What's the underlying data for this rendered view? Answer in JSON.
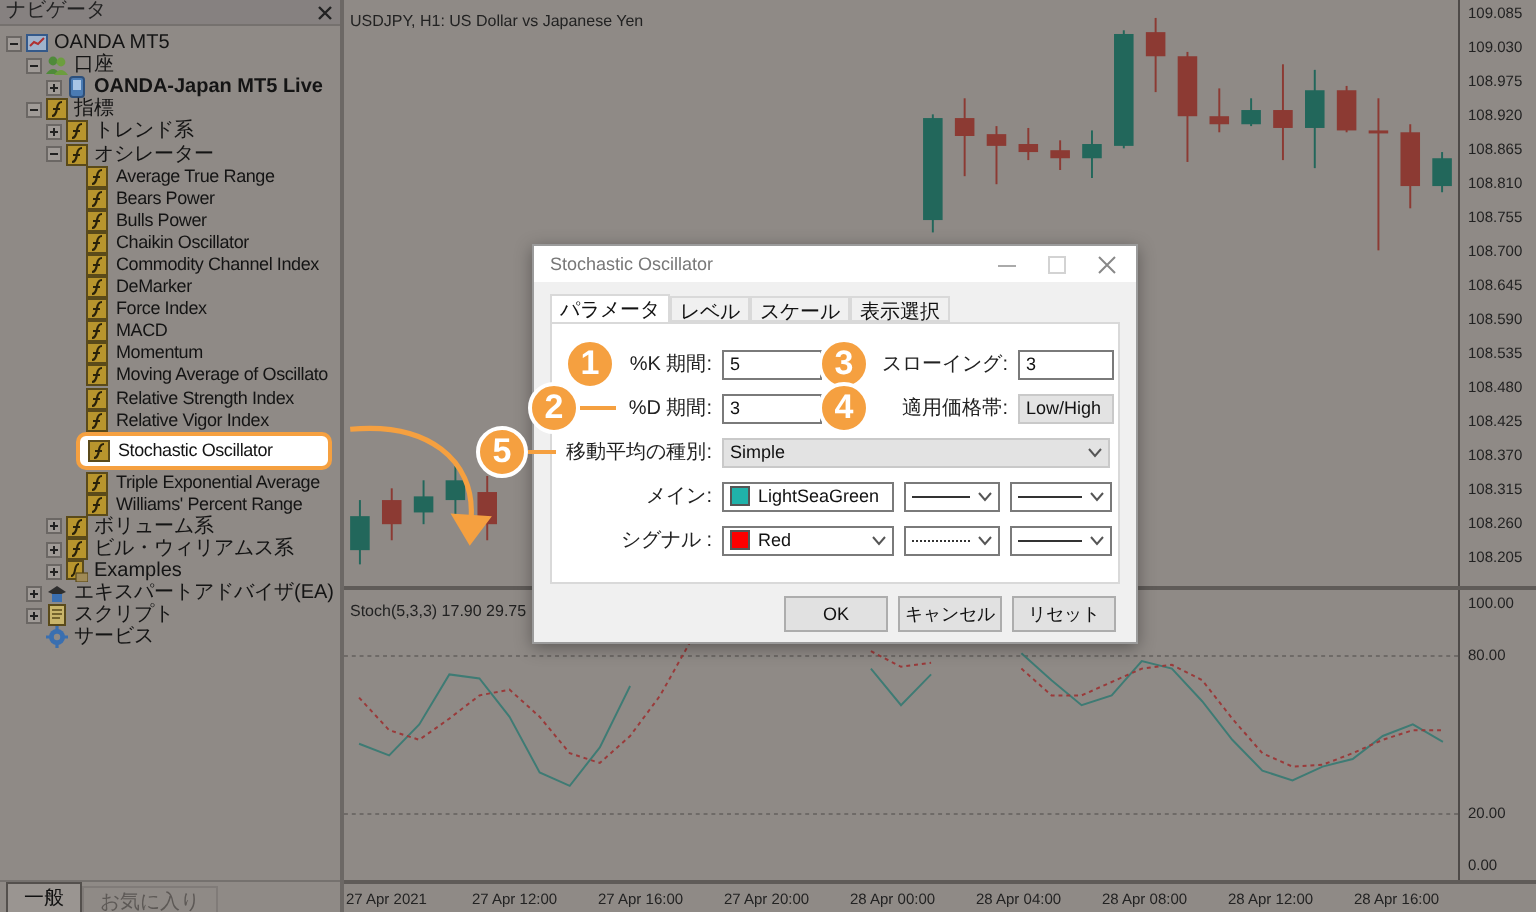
{
  "navigator": {
    "title": "ナビゲータ",
    "tree": [
      {
        "label": "OANDA MT5",
        "kind": "terminal",
        "expanded": true,
        "children": [
          {
            "label": "口座",
            "kind": "accounts",
            "expanded": true,
            "children": [
              {
                "label": "OANDA-Japan MT5 Live",
                "kind": "account",
                "expanded": false
              }
            ]
          },
          {
            "label": "指標",
            "kind": "indicator",
            "expanded": true,
            "children": [
              {
                "label": "トレンド系",
                "kind": "indicator",
                "expanded": false
              },
              {
                "label": "オシレーター",
                "kind": "indicator",
                "expanded": true,
                "children": [
                  {
                    "label": "Average True Range",
                    "kind": "indicator",
                    "highlighted": false
                  },
                  {
                    "label": "Bears Power",
                    "kind": "indicator",
                    "highlighted": false
                  },
                  {
                    "label": "Bulls Power",
                    "kind": "indicator",
                    "highlighted": false
                  },
                  {
                    "label": "Chaikin Oscillator",
                    "kind": "indicator",
                    "highlighted": false
                  },
                  {
                    "label": "Commodity Channel Index",
                    "kind": "indicator",
                    "highlighted": false
                  },
                  {
                    "label": "DeMarker",
                    "kind": "indicator",
                    "highlighted": false
                  },
                  {
                    "label": "Force Index",
                    "kind": "indicator",
                    "highlighted": false
                  },
                  {
                    "label": "MACD",
                    "kind": "indicator",
                    "highlighted": false
                  },
                  {
                    "label": "Momentum",
                    "kind": "indicator",
                    "highlighted": false
                  },
                  {
                    "label": "Moving Average of Oscillato",
                    "kind": "indicator",
                    "highlighted": false
                  },
                  {
                    "label": "Relative Strength Index",
                    "kind": "indicator",
                    "highlighted": false
                  },
                  {
                    "label": "Relative Vigor Index",
                    "kind": "indicator",
                    "highlighted": false
                  },
                  {
                    "label": "Stochastic Oscillator",
                    "kind": "indicator",
                    "highlighted": true
                  },
                  {
                    "label": "Triple Exponential Average",
                    "kind": "indicator",
                    "highlighted": false
                  },
                  {
                    "label": "Williams' Percent Range",
                    "kind": "indicator",
                    "highlighted": false
                  }
                ]
              },
              {
                "label": "ボリューム系",
                "kind": "indicator",
                "expanded": false
              },
              {
                "label": "ビル・ウィリアムス系",
                "kind": "indicator",
                "expanded": false
              },
              {
                "label": "Examples",
                "kind": "indicator-folder",
                "expanded": false
              }
            ]
          },
          {
            "label": "エキスパートアドバイザ(EA)",
            "kind": "expert",
            "expanded": false
          },
          {
            "label": "スクリプト",
            "kind": "script",
            "expanded": false
          },
          {
            "label": "サービス",
            "kind": "service"
          }
        ]
      }
    ],
    "tabs": [
      {
        "label": "一般",
        "selected": true
      },
      {
        "label": "お気に入り",
        "selected": false
      }
    ]
  },
  "chart": {
    "title": "USDJPY, H1:  US Dollar vs Japanese Yen",
    "chart_data": {
      "type": "candlestick",
      "ylim": [
        108.16,
        109.108
      ],
      "yticks": [
        {
          "value": 109.085,
          "label": "109.085"
        },
        {
          "value": 109.03,
          "label": "109.030"
        },
        {
          "value": 108.975,
          "label": "108.975"
        },
        {
          "value": 108.92,
          "label": "108.920"
        },
        {
          "value": 108.865,
          "label": "108.865"
        },
        {
          "value": 108.81,
          "label": "108.810"
        },
        {
          "value": 108.755,
          "label": "108.755"
        },
        {
          "value": 108.7,
          "label": "108.700"
        },
        {
          "value": 108.645,
          "label": "108.645"
        },
        {
          "value": 108.59,
          "label": "108.590"
        },
        {
          "value": 108.535,
          "label": "108.535"
        },
        {
          "value": 108.48,
          "label": "108.480"
        },
        {
          "value": 108.425,
          "label": "108.425"
        },
        {
          "value": 108.37,
          "label": "108.370"
        },
        {
          "value": 108.315,
          "label": "108.315"
        },
        {
          "value": 108.26,
          "label": "108.260"
        },
        {
          "value": 108.205,
          "label": "108.205"
        }
      ],
      "ohlc": [
        [
          108.218,
          108.299,
          108.195,
          108.273
        ],
        [
          108.299,
          108.318,
          108.234,
          108.26
        ],
        [
          108.279,
          108.331,
          108.26,
          108.305
        ],
        [
          108.299,
          108.354,
          108.273,
          108.331
        ],
        [
          108.312,
          108.338,
          108.234,
          108.26
        ],
        null,
        null,
        null,
        null,
        null,
        null,
        null,
        null,
        null,
        null,
        null,
        null,
        null,
        [
          108.752,
          108.923,
          108.732,
          108.917
        ],
        [
          108.917,
          108.949,
          108.823,
          108.888
        ],
        [
          108.891,
          108.904,
          108.81,
          108.872
        ],
        [
          108.875,
          108.901,
          108.849,
          108.862
        ],
        [
          108.865,
          108.881,
          108.833,
          108.852
        ],
        [
          108.852,
          108.897,
          108.82,
          108.875
        ],
        [
          108.872,
          109.059,
          108.868,
          109.053
        ],
        [
          109.056,
          109.079,
          108.959,
          109.017
        ],
        [
          109.017,
          109.024,
          108.846,
          108.92
        ],
        [
          108.92,
          108.965,
          108.894,
          108.907
        ],
        [
          108.907,
          108.949,
          108.904,
          108.93
        ],
        [
          108.93,
          109.004,
          108.849,
          108.901
        ],
        [
          108.901,
          108.995,
          108.836,
          108.962
        ],
        [
          108.962,
          108.969,
          108.894,
          108.897
        ],
        [
          108.897,
          108.949,
          108.703,
          108.894
        ],
        [
          108.894,
          108.907,
          108.771,
          108.807
        ],
        [
          108.807,
          108.862,
          108.797,
          108.852
        ]
      ]
    },
    "indicator": {
      "label": "Stoch(5,3,3) 17.90 29.75",
      "chart_data": {
        "type": "line",
        "ylim": [
          -5,
          105
        ],
        "grid": true,
        "yticks": [
          {
            "value": 100,
            "label": "100.00"
          },
          {
            "value": 80,
            "label": "80.00"
          },
          {
            "value": 20,
            "label": "20.00"
          },
          {
            "value": 0,
            "label": "0.00"
          }
        ],
        "series": [
          {
            "color": "#3e7b74",
            "line_style": "solid",
            "values": [
              46.7,
              42.3,
              54.0,
              73.0,
              71.5,
              56.9,
              35.8,
              30.7,
              45.3,
              68.6,
              null,
              null,
              null,
              null,
              null,
              null,
              null,
              75.2,
              61.3,
              73.0,
              null,
              null,
              81.0,
              70.8,
              61.3,
              65.0,
              78.1,
              75.2,
              62.8,
              48.2,
              36.5,
              32.8,
              38.0,
              40.9,
              49.6,
              54.0,
              47.4
            ]
          },
          {
            "color": "#9a3a3a",
            "line_style": "dashed",
            "values": [
              64.2,
              51.8,
              48.2,
              56.2,
              65.0,
              67.2,
              56.9,
              43.1,
              39.4,
              49.6,
              65.0,
              85.4,
              null,
              null,
              null,
              null,
              null,
              81.8,
              75.9,
              77.4,
              null,
              null,
              75.2,
              65.0,
              65.0,
              70.1,
              75.2,
              76.6,
              70.8,
              56.2,
              43.1,
              38.0,
              38.7,
              43.1,
              48.2,
              51.8,
              51.8
            ]
          }
        ]
      }
    },
    "time_axis": [
      "27 Apr 2021",
      "27 Apr 12:00",
      "27 Apr 16:00",
      "27 Apr 20:00",
      "28 Apr 00:00",
      "28 Apr 04:00",
      "28 Apr 08:00",
      "28 Apr 12:00",
      "28 Apr 16:00"
    ]
  },
  "dialog": {
    "title": "Stochastic Oscillator",
    "tabs": [
      {
        "label": "パラメータ",
        "selected": true
      },
      {
        "label": "レベル",
        "selected": false
      },
      {
        "label": "スケール",
        "selected": false
      },
      {
        "label": "表示選択",
        "selected": false
      }
    ],
    "fields": [
      {
        "label": "%K 期間:",
        "value": "5",
        "kind": "input",
        "callout": "1"
      },
      {
        "label": "スローイング:",
        "value": "3",
        "kind": "input",
        "callout": "3"
      },
      {
        "label": "%D 期間:",
        "value": "3",
        "kind": "input",
        "callout": "2"
      },
      {
        "label": "適用価格帯:",
        "value": "Low/High",
        "kind": "select",
        "callout": "4"
      },
      {
        "label": "移動平均の種別:",
        "value": "Simple",
        "kind": "select",
        "callout": "5"
      }
    ],
    "lines": [
      {
        "label": "メイン:",
        "color_name": "LightSeaGreen",
        "color": "#20b2aa",
        "dashed": false
      },
      {
        "label": "シグナル :",
        "color_name": "Red",
        "color": "#ff0000",
        "dashed": true
      }
    ],
    "buttons": [
      "OK",
      "キャンセル",
      "リセット"
    ]
  }
}
